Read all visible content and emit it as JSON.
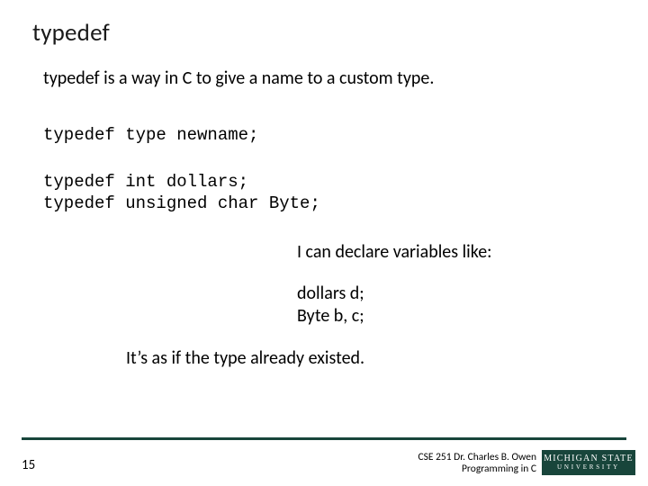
{
  "title": "typedef",
  "subtitle": "typedef is a way in C to give a name to a custom type.",
  "code1": "typedef type newname;",
  "code2_line1": "typedef int dollars;",
  "code2_line2": "typedef unsigned char Byte;",
  "declare_text": "I can declare variables like:",
  "vars_line1": "dollars d;",
  "vars_line2": "Byte b, c;",
  "exist_text": "It’s as if the type already existed.",
  "footer": {
    "page_number": "15",
    "credit_line1": "CSE 251 Dr. Charles B. Owen",
    "credit_line2": "Programming in C",
    "logo_line1": "MICHIGAN STATE",
    "logo_line2": "UNIVERSITY"
  }
}
